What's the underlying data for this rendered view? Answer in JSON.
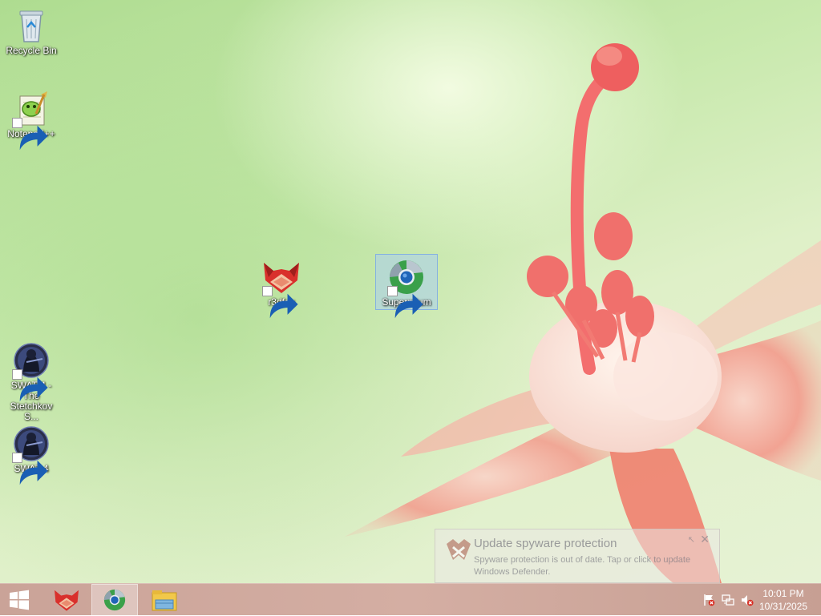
{
  "desktop": {
    "icons": [
      {
        "label": "Recycle Bin"
      },
      {
        "label": "Notepad++"
      },
      {
        "label": "r3dfox"
      },
      {
        "label": "Supermium"
      },
      {
        "label": "SWAT 4 - The Stetchkov S..."
      },
      {
        "label": "SWAT 4"
      }
    ]
  },
  "toast": {
    "title": "Update spyware protection",
    "body": "Spyware protection is out of date. Tap or click to update Windows Defender."
  },
  "clock": {
    "time": "10:01 PM",
    "date": "10/31/2025"
  },
  "colors": {
    "taskbar": "#d0a99e",
    "selection": "#aacdf0"
  }
}
